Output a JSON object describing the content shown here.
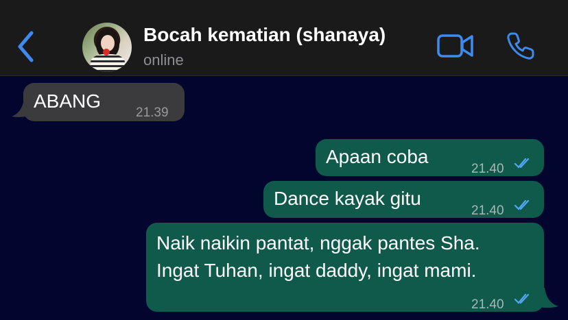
{
  "header": {
    "contact_name": "Bocah kematian (shanaya)",
    "status": "online",
    "back_icon": "chevron-left-icon",
    "video_icon": "video-camera-icon",
    "call_icon": "phone-icon",
    "accent_color": "#3d8bf0"
  },
  "messages": [
    {
      "direction": "incoming",
      "text": "ABANG",
      "time": "21.39"
    },
    {
      "direction": "outgoing",
      "text": "Apaan coba",
      "time": "21.40",
      "status": "read"
    },
    {
      "direction": "outgoing",
      "text": "Dance kayak gitu",
      "time": "21.40",
      "status": "read"
    },
    {
      "direction": "outgoing",
      "lines": [
        "Naik naikin pantat, nggak pantes Sha.",
        "Ingat Tuhan, ingat daddy, ingat mami."
      ],
      "time": "21.40",
      "status": "read"
    }
  ],
  "colors": {
    "background": "#02052e",
    "header": "#1a1a1a",
    "incoming_bubble": "#3b3b3d",
    "outgoing_bubble": "#0f5a4b",
    "read_ticks": "#53a6f5"
  }
}
